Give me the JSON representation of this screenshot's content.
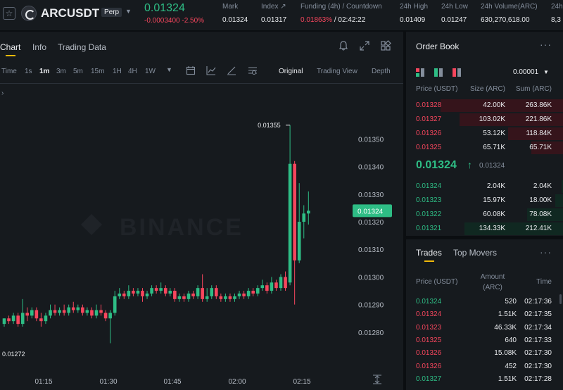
{
  "header": {
    "symbol": "ARCUSDT",
    "contract_type": "Perp",
    "last_price": "0.01324",
    "change": "-0.0003400 -2.50%",
    "stats": [
      {
        "label": "Mark",
        "value": "0.01324",
        "color": "#eaecef"
      },
      {
        "label": "Index ↗",
        "value": "0.01317",
        "color": "#eaecef"
      },
      {
        "label": "Funding (4h) / Countdown",
        "value": "0.01863%",
        "value2": " / 02:42:22",
        "color": "#f6465d"
      },
      {
        "label": "24h High",
        "value": "0.01409",
        "color": "#eaecef"
      },
      {
        "label": "24h Low",
        "value": "0.01247",
        "color": "#eaecef"
      },
      {
        "label": "24h Volume(ARC)",
        "value": "630,270,618.00",
        "color": "#eaecef"
      },
      {
        "label": "24h",
        "value": "8,3",
        "color": "#eaecef"
      }
    ]
  },
  "chart_panel": {
    "tabs": [
      "Chart",
      "Info",
      "Trading Data"
    ],
    "timeframes": [
      "Time",
      "1s",
      "1m",
      "3m",
      "5m",
      "15m",
      "1H",
      "4H",
      "1W"
    ],
    "active_timeframe": "1m",
    "views": [
      "Original",
      "Trading View",
      "Depth"
    ],
    "active_view": "Original",
    "watermark": "BINANCE",
    "icons": [
      "bell-icon",
      "expand-icon",
      "grid-icon",
      "calendar-icon",
      "indicator-icon",
      "draw-icon",
      "settings-icon",
      "chevron-down-icon",
      "arrow-icon",
      "scale-icon"
    ]
  },
  "chart_data": {
    "type": "candlestick",
    "x_labels": [
      "01:15",
      "01:30",
      "01:45",
      "02:00",
      "02:15"
    ],
    "y_ticks": [
      "0.01280",
      "0.01290",
      "0.01300",
      "0.01310",
      "0.01320",
      "0.01330",
      "0.01340",
      "0.01350"
    ],
    "ylim": [
      0.01269,
      0.0137
    ],
    "current_price_label": "0.01324",
    "current_price": 0.01324,
    "high_annotation": "0.01355",
    "high_value": 0.01355,
    "low_annotation": "0.01272",
    "low_value": 0.01272,
    "up_color": "#2ebd85",
    "down_color": "#f6465d",
    "candles": [
      [
        0.01283,
        0.01285,
        0.01285,
        0.01282
      ],
      [
        0.01285,
        0.01284,
        0.01286,
        0.01283
      ],
      [
        0.01284,
        0.01286,
        0.01287,
        0.01283
      ],
      [
        0.01286,
        0.01283,
        0.01287,
        0.01282
      ],
      [
        0.01283,
        0.01287,
        0.01292,
        0.01282
      ],
      [
        0.01287,
        0.01286,
        0.01289,
        0.01284
      ],
      [
        0.01286,
        0.01288,
        0.01289,
        0.01285
      ],
      [
        0.01288,
        0.01285,
        0.01289,
        0.01284
      ],
      [
        0.01285,
        0.01284,
        0.01287,
        0.01282
      ],
      [
        0.01284,
        0.01286,
        0.01287,
        0.01283
      ],
      [
        0.01286,
        0.01288,
        0.0129,
        0.01285
      ],
      [
        0.01288,
        0.01287,
        0.0129,
        0.01286
      ],
      [
        0.01287,
        0.01288,
        0.01289,
        0.01286
      ],
      [
        0.01288,
        0.01287,
        0.0129,
        0.01286
      ],
      [
        0.01287,
        0.01289,
        0.0129,
        0.01286
      ],
      [
        0.01289,
        0.01288,
        0.01291,
        0.01287
      ],
      [
        0.01288,
        0.01289,
        0.0129,
        0.01287
      ],
      [
        0.01289,
        0.01287,
        0.0129,
        0.01286
      ],
      [
        0.01287,
        0.01288,
        0.01289,
        0.01286
      ],
      [
        0.01288,
        0.01286,
        0.01289,
        0.01285
      ],
      [
        0.01286,
        0.01288,
        0.0129,
        0.01285
      ],
      [
        0.01288,
        0.01287,
        0.0129,
        0.01286
      ],
      [
        0.01287,
        0.01285,
        0.01288,
        0.01284
      ],
      [
        0.01285,
        0.01287,
        0.01288,
        0.01276
      ],
      [
        0.01287,
        0.01293,
        0.01295,
        0.01286
      ],
      [
        0.01293,
        0.01294,
        0.01296,
        0.01292
      ],
      [
        0.01294,
        0.01293,
        0.01295,
        0.01292
      ],
      [
        0.01293,
        0.01295,
        0.01297,
        0.01292
      ],
      [
        0.01295,
        0.01294,
        0.01296,
        0.01293
      ],
      [
        0.01294,
        0.01295,
        0.01296,
        0.01293
      ],
      [
        0.01295,
        0.01293,
        0.01296,
        0.01291
      ],
      [
        0.01293,
        0.01294,
        0.01295,
        0.01292
      ],
      [
        0.01294,
        0.01296,
        0.01297,
        0.01293
      ],
      [
        0.01296,
        0.01295,
        0.01297,
        0.01294
      ],
      [
        0.01295,
        0.01296,
        0.01298,
        0.01294
      ],
      [
        0.01296,
        0.01294,
        0.01297,
        0.01293
      ],
      [
        0.01294,
        0.01295,
        0.01296,
        0.01293
      ],
      [
        0.01295,
        0.01292,
        0.01296,
        0.01291
      ],
      [
        0.01292,
        0.01293,
        0.01294,
        0.01291
      ],
      [
        0.01293,
        0.01292,
        0.01294,
        0.01291
      ],
      [
        0.01292,
        0.01294,
        0.01295,
        0.01291
      ],
      [
        0.01294,
        0.01293,
        0.01295,
        0.01292
      ],
      [
        0.01293,
        0.01296,
        0.01297,
        0.01292
      ],
      [
        0.01296,
        0.01292,
        0.01301,
        0.01291
      ],
      [
        0.01292,
        0.01293,
        0.01296,
        0.01291
      ],
      [
        0.01293,
        0.01296,
        0.01297,
        0.01292
      ],
      [
        0.01296,
        0.01293,
        0.01297,
        0.01292
      ],
      [
        0.01293,
        0.01292,
        0.01294,
        0.01291
      ],
      [
        0.01292,
        0.01293,
        0.01294,
        0.01291
      ],
      [
        0.01293,
        0.01292,
        0.01294,
        0.01291
      ],
      [
        0.01292,
        0.01293,
        0.01294,
        0.01291
      ],
      [
        0.01293,
        0.01294,
        0.01295,
        0.01292
      ],
      [
        0.01294,
        0.01293,
        0.01295,
        0.01292
      ],
      [
        0.01293,
        0.01295,
        0.01296,
        0.01292
      ],
      [
        0.01295,
        0.01294,
        0.01296,
        0.01293
      ],
      [
        0.01294,
        0.01296,
        0.01297,
        0.01293
      ],
      [
        0.01296,
        0.01297,
        0.01299,
        0.01295
      ],
      [
        0.01297,
        0.01295,
        0.01298,
        0.01294
      ],
      [
        0.01295,
        0.01298,
        0.013,
        0.01294
      ],
      [
        0.01298,
        0.01296,
        0.01299,
        0.01295
      ],
      [
        0.01296,
        0.013,
        0.01301,
        0.01295
      ],
      [
        0.013,
        0.01296,
        0.01302,
        0.01295
      ],
      [
        0.01298,
        0.01341,
        0.01355,
        0.01297
      ],
      [
        0.01341,
        0.01306,
        0.01342,
        0.0129
      ],
      [
        0.01306,
        0.0132,
        0.01334,
        0.01305
      ],
      [
        0.0132,
        0.01323,
        0.01326,
        0.01314
      ],
      [
        0.01323,
        0.01324,
        0.01331,
        0.01319
      ]
    ]
  },
  "orderbook": {
    "title": "Order Book",
    "precision": "0.00001",
    "columns": [
      "Price (USDT)",
      "Size (ARC)",
      "Sum (ARC)"
    ],
    "asks": [
      {
        "price": "0.01328",
        "size": "42.00K",
        "sum": "263.86K",
        "depth": 0.78
      },
      {
        "price": "0.01327",
        "size": "103.02K",
        "sum": "221.86K",
        "depth": 0.66
      },
      {
        "price": "0.01326",
        "size": "53.12K",
        "sum": "118.84K",
        "depth": 0.35
      },
      {
        "price": "0.01325",
        "size": "65.71K",
        "sum": "65.71K",
        "depth": 0.2
      }
    ],
    "mid_price": "0.01324",
    "mid_mark": "0.01324",
    "bids": [
      {
        "price": "0.01324",
        "size": "2.04K",
        "sum": "2.04K",
        "depth": 0.01
      },
      {
        "price": "0.01323",
        "size": "15.97K",
        "sum": "18.00K",
        "depth": 0.05
      },
      {
        "price": "0.01322",
        "size": "60.08K",
        "sum": "78.08K",
        "depth": 0.23
      },
      {
        "price": "0.01321",
        "size": "134.33K",
        "sum": "212.41K",
        "depth": 0.63
      }
    ]
  },
  "trades": {
    "tabs": [
      "Trades",
      "Top Movers"
    ],
    "columns": [
      "Price (USDT)",
      "Amount (ARC)",
      "Time"
    ],
    "rows": [
      {
        "price": "0.01324",
        "amount": "520",
        "time": "02:17:36",
        "side": "buy"
      },
      {
        "price": "0.01324",
        "amount": "1.51K",
        "time": "02:17:35",
        "side": "sell"
      },
      {
        "price": "0.01323",
        "amount": "46.33K",
        "time": "02:17:34",
        "side": "sell"
      },
      {
        "price": "0.01325",
        "amount": "640",
        "time": "02:17:33",
        "side": "sell"
      },
      {
        "price": "0.01326",
        "amount": "15.08K",
        "time": "02:17:30",
        "side": "sell"
      },
      {
        "price": "0.01326",
        "amount": "452",
        "time": "02:17:30",
        "side": "sell"
      },
      {
        "price": "0.01327",
        "amount": "1.51K",
        "time": "02:17:28",
        "side": "buy"
      }
    ]
  }
}
